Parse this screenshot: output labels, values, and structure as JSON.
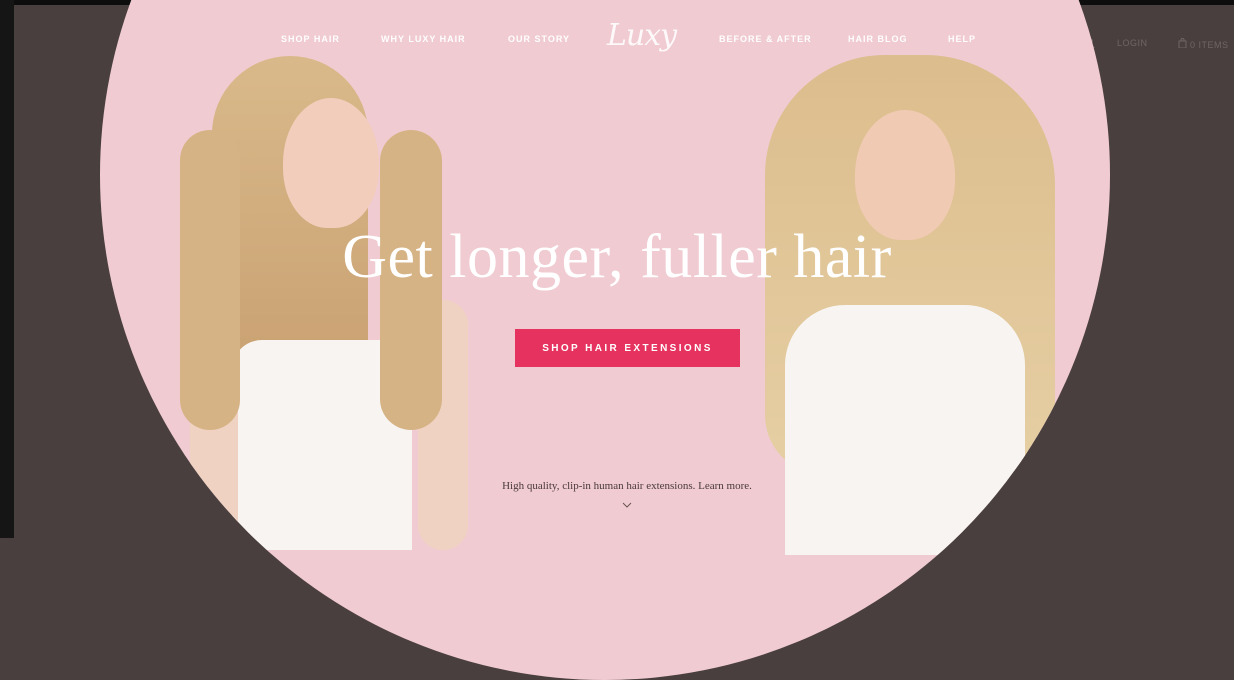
{
  "nav": {
    "left": [
      "SHOP HAIR",
      "WHY LUXY HAIR",
      "OUR STORY"
    ],
    "logo": "Luxy",
    "right": [
      "BEFORE & AFTER",
      "HAIR BLOG",
      "HELP"
    ]
  },
  "utility": {
    "account_icon": "user-icon",
    "login_label": "LOGIN",
    "cart_icon": "bag-icon",
    "cart_label": "0 ITEMS"
  },
  "hero": {
    "headline": "Get longer, fuller hair",
    "cta_label": "SHOP HAIR EXTENSIONS",
    "tagline": "High quality, clip-in human hair extensions. Learn more.",
    "scroll_icon": "chevron-down-icon"
  },
  "colors": {
    "background": "#4a3f3f",
    "hero_pink": "#f0cbd1",
    "cta": "#e6325e",
    "text_light": "#ffffff"
  }
}
